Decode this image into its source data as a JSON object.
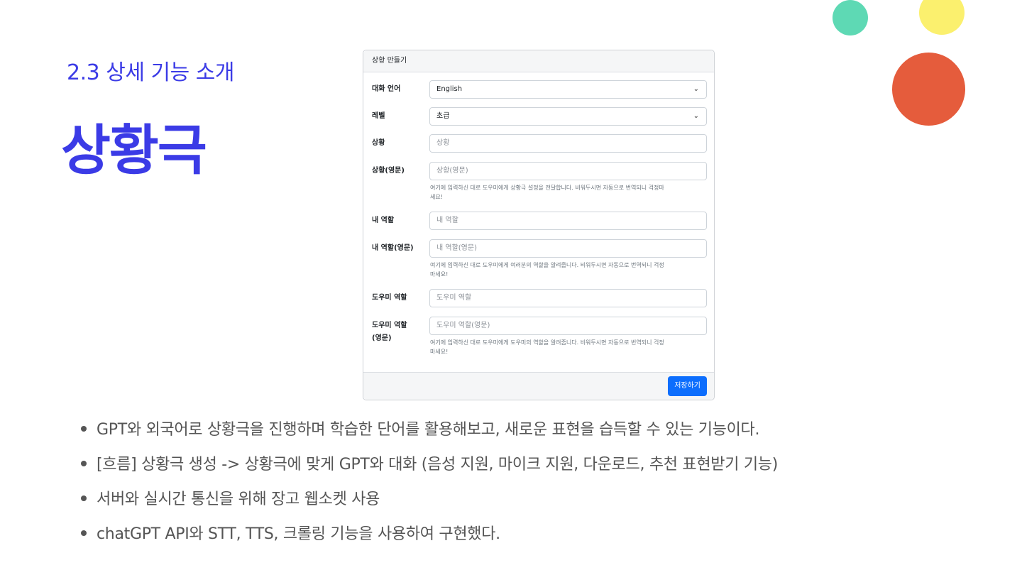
{
  "slide": {
    "subtitle": "2.3 상세 기능 소개",
    "title": "상황극",
    "colors": {
      "accent": "#3b3be6",
      "green": "#5ed9b4",
      "yellow": "#fbf06e",
      "red": "#e55c3c"
    }
  },
  "form": {
    "header": "상황 만들기",
    "fields": [
      {
        "label": "대화 언어",
        "value": "English",
        "type": "select"
      },
      {
        "label": "레벨",
        "value": "초급",
        "type": "select"
      },
      {
        "label": "상황",
        "placeholder": "상황"
      },
      {
        "label": "상황(영문)",
        "placeholder": "상황(영문)",
        "help": "여기에 입력하신 대로 도우미에게 상황극 설정을 전달합니다. 비워두시면 자동으로 번역되니 걱정마\n세요!"
      },
      {
        "label": "내 역할",
        "placeholder": "내 역할"
      },
      {
        "label": "내 역할(영문)",
        "placeholder": "내 역할(영문)",
        "help": "여기에 입력하신 대로 도우미에게 여러분의 역할을 알려줍니다. 비워두시면 자동으로 번역되니 걱정\n마세요!"
      },
      {
        "label": "도우미 역할",
        "placeholder": "도우미 역할"
      },
      {
        "label": "도우미 역할\n(영문)",
        "placeholder": "도우미 역할(영문)",
        "help": "여기에 입력하신 대로 도우미에게 도우미의 역할을 알려줍니다. 비워두시면 자동으로 번역되니 걱정\n마세요!"
      }
    ],
    "save_label": "저장하기"
  },
  "bullets": [
    "GPT와 외국어로 상황극을 진행하며 학습한 단어를 활용해보고, 새로운 표현을 습득할 수 있는 기능이다.",
    "[흐름] 상황극 생성 -> 상황극에 맞게 GPT와 대화 (음성 지원, 마이크 지원, 다운로드, 추천 표현받기 기능)",
    "서버와 실시간 통신을 위해 장고 웹소켓 사용",
    "chatGPT API와 STT, TTS, 크롤링 기능을 사용하여 구현했다."
  ]
}
